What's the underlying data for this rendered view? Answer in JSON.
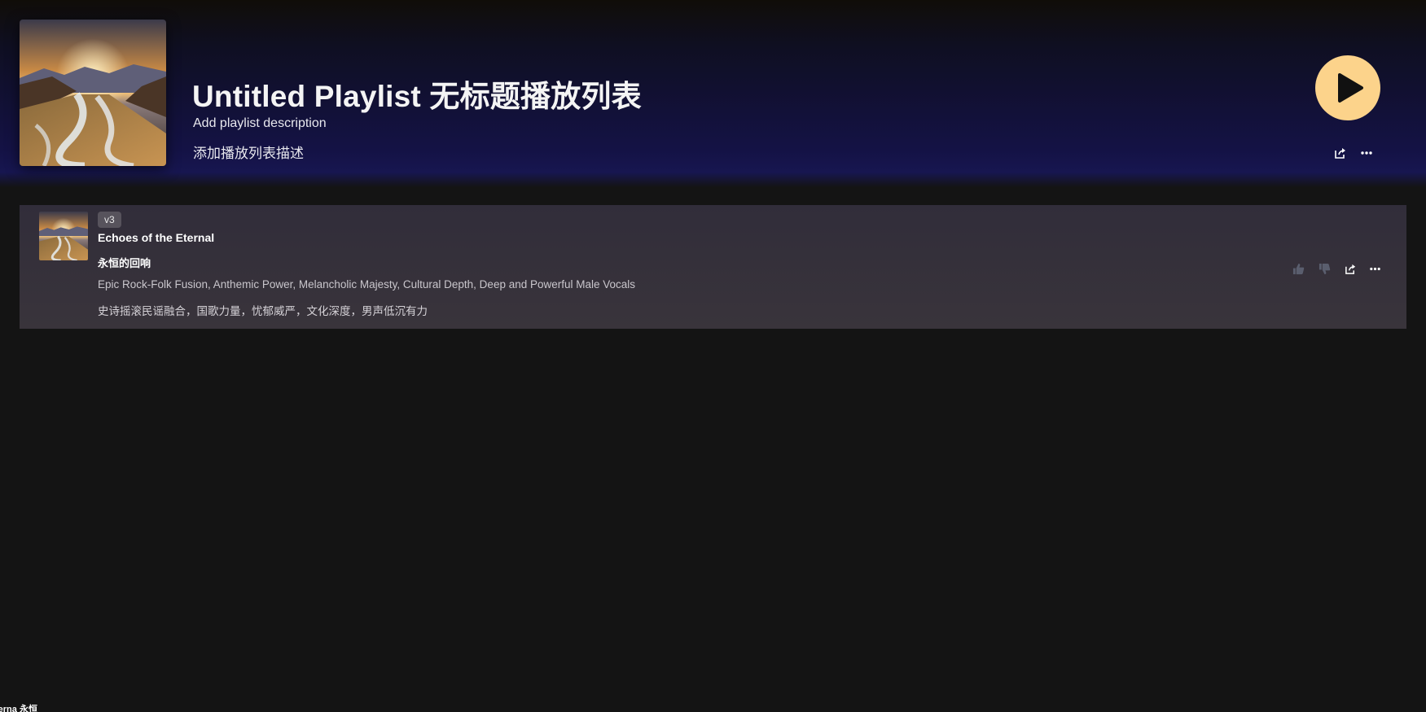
{
  "playlist": {
    "title": "Untitled Playlist 无标题播放列表",
    "description_en": "Add playlist description",
    "description_zh": "添加播放列表描述",
    "cover_icon": "landscape-cover-image"
  },
  "header_actions": {
    "play_icon": "play-icon",
    "share_icon": "share-icon",
    "more_icon": "more-icon"
  },
  "songs": [
    {
      "version": "v3",
      "title": "Echoes of the Eternal",
      "title_zh": "永恒的回响",
      "tags": "Epic Rock-Folk Fusion, Anthemic Power, Melancholic Majesty, Cultural Depth, Deep and Powerful Male Vocals",
      "tags_zh": "史诗摇滚民谣融合，国歌力量，忧郁威严，文化深度，男声低沉有力"
    }
  ],
  "footer": {
    "text": "terna 永恒"
  },
  "colors": {
    "background": "#141414",
    "accent": "#fcd38b",
    "header_gradient_end": "#171650",
    "row_background": "#36323b"
  }
}
